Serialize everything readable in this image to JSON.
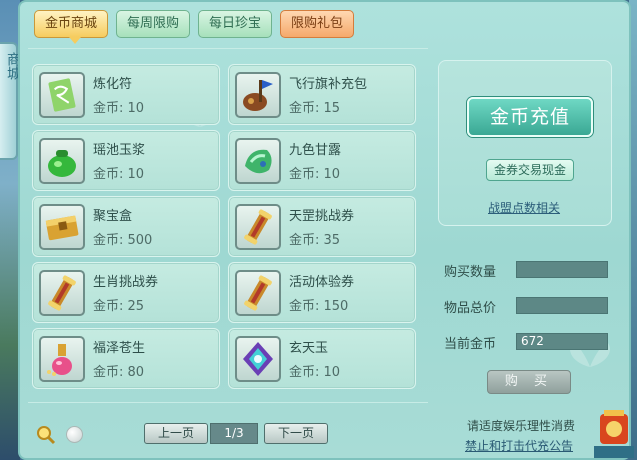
{
  "left_tab": {
    "label": "商城"
  },
  "tabs": [
    {
      "label": "金币商城",
      "active": true
    },
    {
      "label": "每周限购",
      "active": false
    },
    {
      "label": "每日珍宝",
      "active": false
    },
    {
      "label": "限购礼包",
      "active": false
    }
  ],
  "items": [
    {
      "name": "炼化符",
      "price": "金币: 10",
      "icon": "talisman-icon"
    },
    {
      "name": "飞行旗补充包",
      "price": "金币: 15",
      "icon": "flag-pack-icon"
    },
    {
      "name": "瑶池玉浆",
      "price": "金币: 10",
      "icon": "jade-pouch-icon"
    },
    {
      "name": "九色甘露",
      "price": "金币: 10",
      "icon": "jade-stone-icon"
    },
    {
      "name": "聚宝盒",
      "price": "金币: 500",
      "icon": "treasure-box-icon"
    },
    {
      "name": "天罡挑战券",
      "price": "金币: 35",
      "icon": "scroll-icon"
    },
    {
      "name": "生肖挑战券",
      "price": "金币: 25",
      "icon": "scroll-icon"
    },
    {
      "name": "活动体验券",
      "price": "金币: 150",
      "icon": "scroll-icon"
    },
    {
      "name": "福泽苍生",
      "price": "金币: 80",
      "icon": "potion-icon"
    },
    {
      "name": "玄天玉",
      "price": "金币: 10",
      "icon": "gem-icon"
    }
  ],
  "side": {
    "recharge_label": "金币充值",
    "exchange_label": "金券交易现金",
    "alliance_label": "战盟点数相关"
  },
  "purchase": {
    "quantity_label": "购买数量",
    "quantity_value": "",
    "total_label": "物品总价",
    "total_value": "",
    "gold_label": "当前金币",
    "gold_value": "672",
    "buy_label": "购 买"
  },
  "pagination": {
    "prev_label": "上一页",
    "page_indicator": "1/3",
    "next_label": "下一页"
  },
  "notice": {
    "line1": "请适度娱乐理性消费",
    "line2": "禁止和打击代充公告"
  },
  "colors": {
    "panel_bg": "#a6ddd6",
    "active_tab": "#f6cc5e",
    "gift_tab": "#f5a96b",
    "recharge": "#3aa894"
  }
}
